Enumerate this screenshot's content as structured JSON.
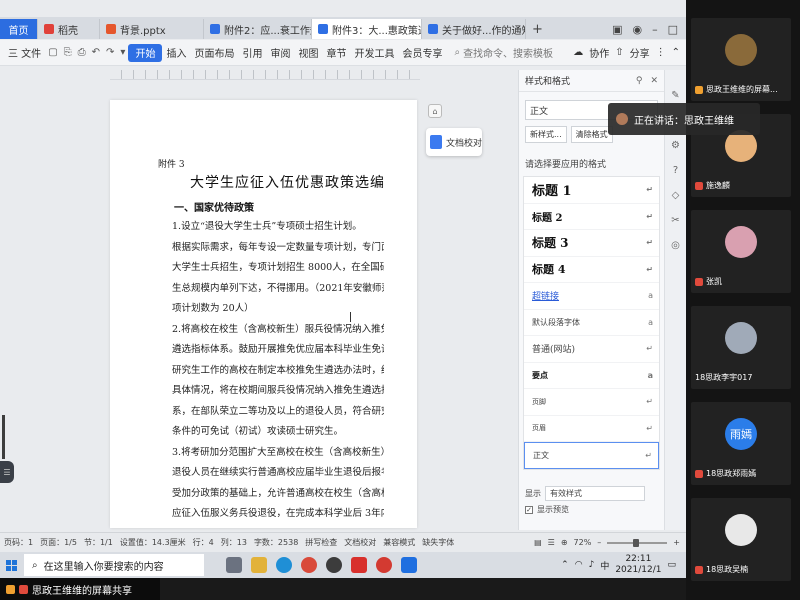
{
  "tabs": [
    {
      "label": "首页",
      "kind": "home",
      "color": "#2c6de0"
    },
    {
      "label": "稻壳",
      "kind": "normal",
      "color": "#e0413a"
    },
    {
      "label": "背景.pptx",
      "kind": "normal",
      "color": "#e5562c"
    },
    {
      "label": "附件2：应...衰工作规定",
      "kind": "normal",
      "color": "#2f6fe4"
    },
    {
      "label": "附件3：大...惠政策选编",
      "kind": "active",
      "color": "#2f6fe4"
    },
    {
      "label": "关于做好...作的通知",
      "kind": "normal",
      "color": "#2f6fe4"
    }
  ],
  "toolbar": {
    "file": "三 文件",
    "menus": [
      "开始",
      "插入",
      "页面布局",
      "引用",
      "审阅",
      "视图",
      "章节",
      "开发工具",
      "会员专享"
    ],
    "search": "查找命令、搜索模板",
    "share": "分享",
    "collab": "协作"
  },
  "document": {
    "attach": "附件 3",
    "title": "大学生应征入伍优惠政策选编",
    "h1": "一、国家优待政策",
    "lines": [
      "1.设立“退役大学生士兵”专项硕士招生计划。",
      "根据实际需求，每年专设一定数量专项计划，专门面向退役",
      "大学生士兵招生，专项计划招生 8000人，在全国研究生招",
      "生总规模内单列下达，不得挪用。（2021年安徽师范大学专",
      "项计划数为 20人）",
      "2.将高校在校生（含高校新生）服兵役情况纳入推免生",
      "遴选指标体系。鼓励开展推免优应届本科毕业生免试攻读",
      "研究生工作的高校在制定本校推免生遴选办法时，结合本校",
      "具体情况，将在校期间服兵役情况纳入推免生遴选指标体",
      "系，在部队荣立二等功及以上的退役人员，符合研究生报名",
      "条件的可免试（初试）攻读硕士研究生。",
      "3.将考研加分范围扩大至高校在校生（含高校新生），",
      "退役人员在继续实行普通高校应届毕业生退役后报考研究生",
      "受加分政策的基础上，允许普通高校在校生（含高校新生）",
      "应征入伍服义务兵役退役，在完成本科学业后 3年内参加全"
    ],
    "proof_label": "文档校对"
  },
  "panel": {
    "title": "样式和格式",
    "current": "正文",
    "btn_new": "新样式...",
    "btn_clear": "清除格式",
    "subtitle": "请选择要应用的格式",
    "styles": [
      "标题 1",
      "标题 2",
      "标题 3",
      "标题 4",
      "超链接",
      "默认段落字体",
      "普通(网站)",
      "要点",
      "页脚",
      "页眉",
      "正文"
    ],
    "show_label": "显示",
    "show_value": "有效样式",
    "preview_label": "显示预览"
  },
  "speaking": "正在讲话：思政王维维",
  "status": {
    "page": "页码：1",
    "pages": "页面：1/5",
    "section": "节：1/1",
    "setting": "设置值：14.3厘米",
    "row": "行：4",
    "col": "列：13",
    "words": "字数：2538",
    "spell": "拼写检查",
    "proof": "文档校对",
    "compat": "兼容模式",
    "font_missing": "缺失字体",
    "zoom": "72%"
  },
  "taskbar": {
    "search_placeholder": "在这里输入你要搜索的内容",
    "ime": "中",
    "time": "22:11",
    "date": "2021/12/1"
  },
  "share_bar": "思政王维维的屏幕共享",
  "participants": [
    {
      "name": "思政王维维的屏幕...",
      "avatar": "",
      "color": "#8a6a3a"
    },
    {
      "name": "施逸麟",
      "avatar": "",
      "color": "#e7b27a"
    },
    {
      "name": "张凯",
      "avatar": "",
      "color": "#d9a0b0"
    },
    {
      "name": "18思政李宇017",
      "avatar": "",
      "color": "#a0aab8"
    },
    {
      "name": "18思政郑雨嫣",
      "avatar": "雨嫣",
      "color": "#2b7de9"
    },
    {
      "name": "18思政吴楠",
      "avatar": "",
      "color": "#e8e8e8"
    }
  ]
}
